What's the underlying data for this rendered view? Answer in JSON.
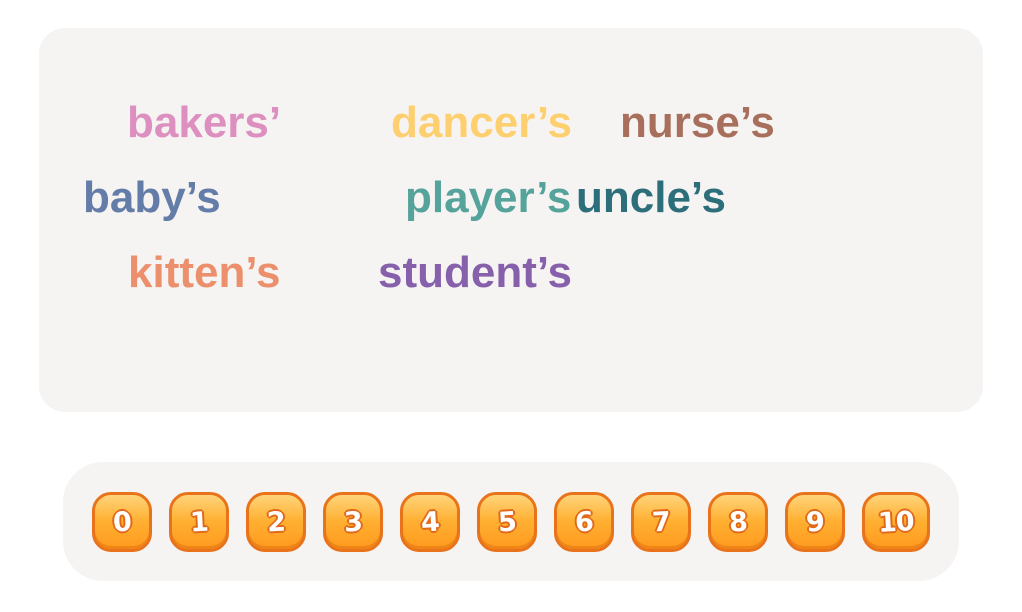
{
  "words": [
    {
      "text": "bakers’",
      "color": "#dd8fc0"
    },
    {
      "text": "dancer’s",
      "color": "#fdcf6e"
    },
    {
      "text": "nurse’s",
      "color": "#a86f5c"
    },
    {
      "text": "baby’s",
      "color": "#637ca8"
    },
    {
      "text": "player’s",
      "color": "#55a39b"
    },
    {
      "text": "uncle’s",
      "color": "#2c6e7a"
    },
    {
      "text": "kitten’s",
      "color": "#eb8f6c"
    },
    {
      "text": "student’s",
      "color": "#8660ab"
    }
  ],
  "answer_buttons": [
    "0",
    "1",
    "2",
    "3",
    "4",
    "5",
    "6",
    "7",
    "8",
    "9",
    "10"
  ],
  "colors": {
    "panel_background": "#f6f4f3",
    "button_fill": "#ffb032",
    "button_border": "#e8731a"
  }
}
